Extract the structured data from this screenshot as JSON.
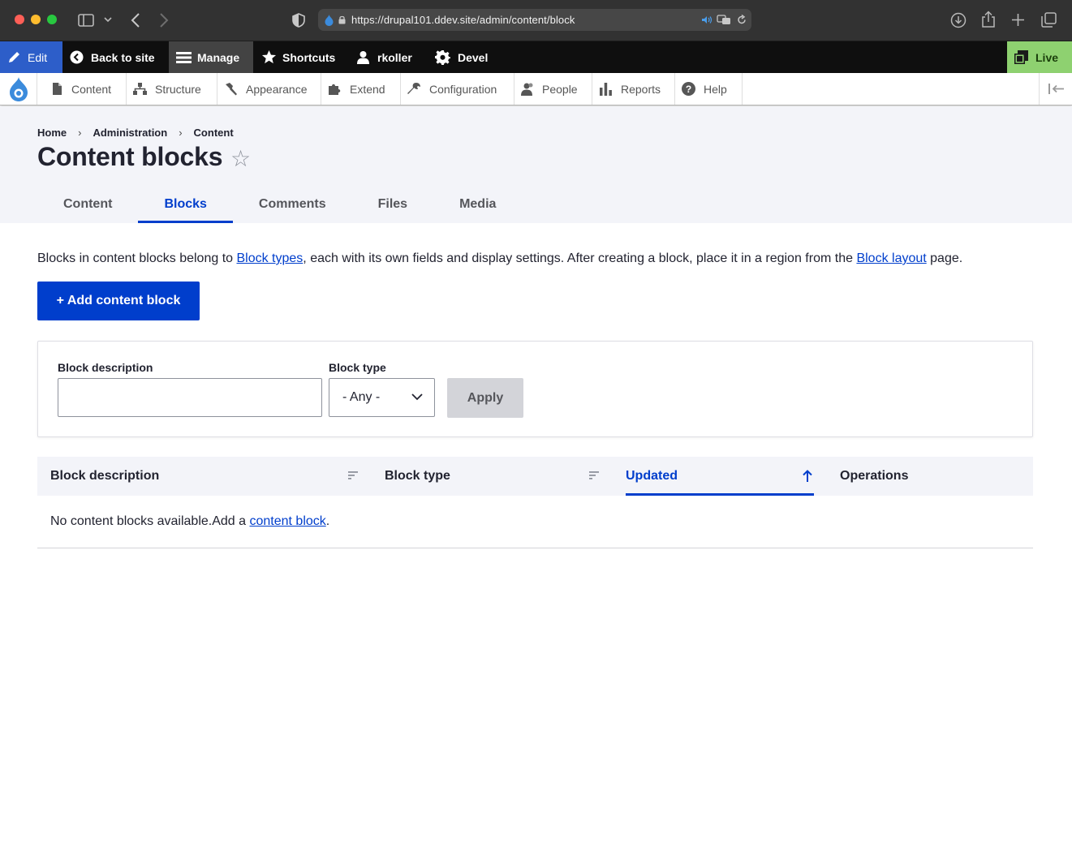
{
  "browser": {
    "url": "https://drupal101.ddev.site/admin/content/block"
  },
  "toolbar": {
    "edit": "Edit",
    "back_to_site": "Back to site",
    "manage": "Manage",
    "shortcuts": "Shortcuts",
    "user": "rkoller",
    "devel": "Devel",
    "live": "Live"
  },
  "admin_menu": {
    "items": [
      {
        "label": "Content",
        "icon": "file-icon"
      },
      {
        "label": "Structure",
        "icon": "sitemap-icon"
      },
      {
        "label": "Appearance",
        "icon": "brush-icon"
      },
      {
        "label": "Extend",
        "icon": "puzzle-icon"
      },
      {
        "label": "Configuration",
        "icon": "wrench-icon"
      },
      {
        "label": "People",
        "icon": "people-icon"
      },
      {
        "label": "Reports",
        "icon": "bar-chart-icon"
      },
      {
        "label": "Help",
        "icon": "help-icon"
      }
    ]
  },
  "breadcrumb": [
    "Home",
    "Administration",
    "Content"
  ],
  "page": {
    "title": "Content blocks",
    "tabs": [
      "Content",
      "Blocks",
      "Comments",
      "Files",
      "Media"
    ],
    "active_tab": "Blocks"
  },
  "intro": {
    "prefix": "Blocks in content blocks belong to ",
    "link1": "Block types",
    "middle": ", each with its own fields and display settings. After creating a block, place it in a region from the ",
    "link2": "Block layout",
    "suffix": " page."
  },
  "add_button": "+ Add content block",
  "filters": {
    "description_label": "Block description",
    "description_value": "",
    "type_label": "Block type",
    "type_value": "- Any -",
    "apply": "Apply"
  },
  "table": {
    "columns": [
      "Block description",
      "Block type",
      "Updated",
      "Operations"
    ],
    "sorted_column": "Updated",
    "empty_prefix": "No content blocks available.Add a ",
    "empty_link": "content block",
    "empty_suffix": "."
  },
  "colors": {
    "primary": "#003ecc",
    "toolbar_edit": "#2d5ec9",
    "live": "#8ed170"
  }
}
